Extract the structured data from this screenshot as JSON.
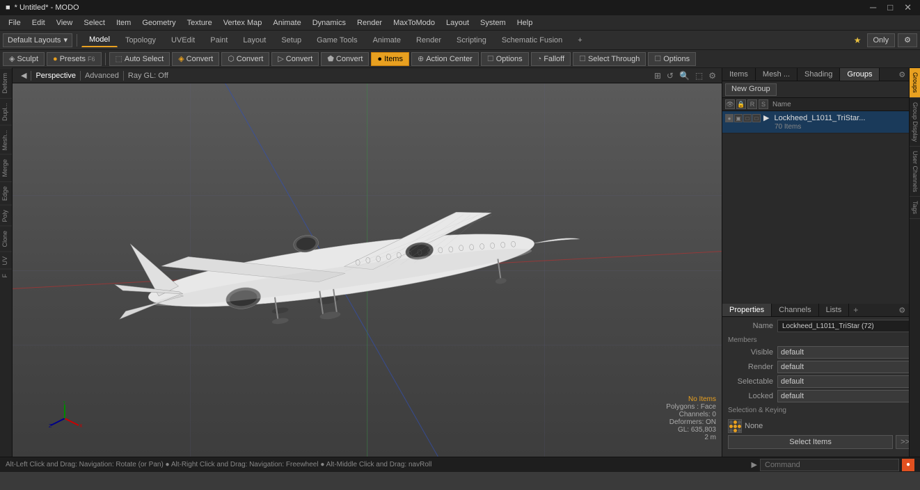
{
  "titlebar": {
    "title": "* Untitled* - MODO",
    "minimize": "─",
    "maximize": "□",
    "close": "✕"
  },
  "menubar": {
    "items": [
      "File",
      "Edit",
      "View",
      "Select",
      "Item",
      "Geometry",
      "Texture",
      "Vertex Map",
      "Animate",
      "Dynamics",
      "Render",
      "MaxToModo",
      "Layout",
      "System",
      "Help"
    ]
  },
  "toolbar1": {
    "layout_dropdown": "Default Layouts",
    "tabs": [
      "Model",
      "Topology",
      "UVEdit",
      "Paint",
      "Layout",
      "Setup",
      "Game Tools",
      "Animate",
      "Render",
      "Scripting",
      "Schematic Fusion"
    ],
    "add_tab": "+",
    "star_label": "Only"
  },
  "toolbar2": {
    "sculpt_label": "Sculpt",
    "presets_label": "Presets",
    "presets_shortcut": "F6",
    "auto_select_label": "Auto Select",
    "convert_buttons": [
      "Convert",
      "Convert",
      "Convert",
      "Convert"
    ],
    "items_label": "Items",
    "action_center_label": "Action Center",
    "options_label1": "Options",
    "falloff_label": "Falloff",
    "options_label2": "Options",
    "select_through_label": "Select Through"
  },
  "viewport": {
    "perspective_label": "Perspective",
    "advanced_label": "Advanced",
    "rayoff_label": "Ray GL: Off",
    "toggle": "◀"
  },
  "status": {
    "no_items": "No Items",
    "polygons": "Polygons : Face",
    "channels": "Channels: 0",
    "deformers": "Deformers: ON",
    "gl": "GL: 635,803",
    "distance": "2 m"
  },
  "statusbar": {
    "nav_text": "Alt-Left Click and Drag: Navigation: Rotate (or Pan) ● Alt-Right Click and Drag: Navigation: Freewheel ● Alt-Middle Click and Drag: navRoll",
    "command_placeholder": "Command",
    "arrow_label": "▶"
  },
  "right_panel": {
    "groups_tabs": [
      "Items",
      "Mesh ...",
      "Shading",
      "Groups"
    ],
    "new_group_label": "New Group",
    "list_header_name": "Name",
    "group_item": {
      "name": "Lockheed_L1011_TriStar...",
      "count": "70 Items"
    },
    "props_tabs": [
      "Properties",
      "Channels",
      "Lists"
    ],
    "props_add": "+",
    "name_label": "Name",
    "name_value": "Lockheed_L1011_TriStar (72)",
    "members_label": "Members",
    "visible_label": "Visible",
    "visible_value": "default",
    "render_label": "Render",
    "render_value": "default",
    "selectable_label": "Selectable",
    "selectable_value": "default",
    "locked_label": "Locked",
    "locked_value": "default",
    "sel_keying_label": "Selection & Keying",
    "none_label": "None",
    "select_items_label": "Select Items",
    "more_label": ">>"
  },
  "side_tabs": {
    "items": [
      "Groups",
      "Group Display",
      "User Channels",
      "Tags"
    ]
  }
}
